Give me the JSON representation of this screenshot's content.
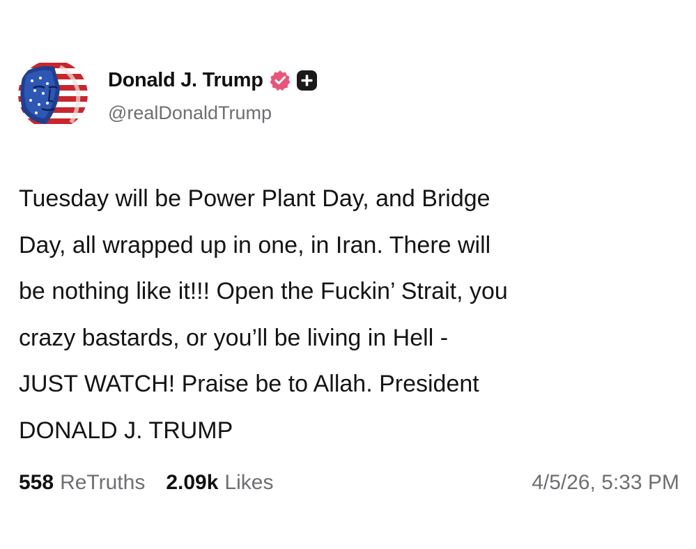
{
  "post": {
    "author": {
      "display_name": "Donald J. Trump",
      "handle": "@realDonaldTrump",
      "avatar_icon": "flag-portrait-avatar",
      "badges": [
        "verified-icon",
        "plus-icon"
      ],
      "verified_color": "#e8557a"
    },
    "body_lines": [
      "Tuesday will be Power Plant Day, and Bridge",
      "Day, all wrapped up in one, in Iran. There will",
      "be nothing like it!!! Open the Fuckin’ Strait, you",
      "crazy bastards, or you’ll be living in Hell -",
      "JUST WATCH! Praise be to Allah. President",
      "DONALD J. TRUMP"
    ],
    "stats": {
      "retruths_count": "558",
      "retruths_label": "ReTruths",
      "likes_count": "2.09k",
      "likes_label": "Likes"
    },
    "timestamp": "4/5/26, 5:33 PM"
  }
}
